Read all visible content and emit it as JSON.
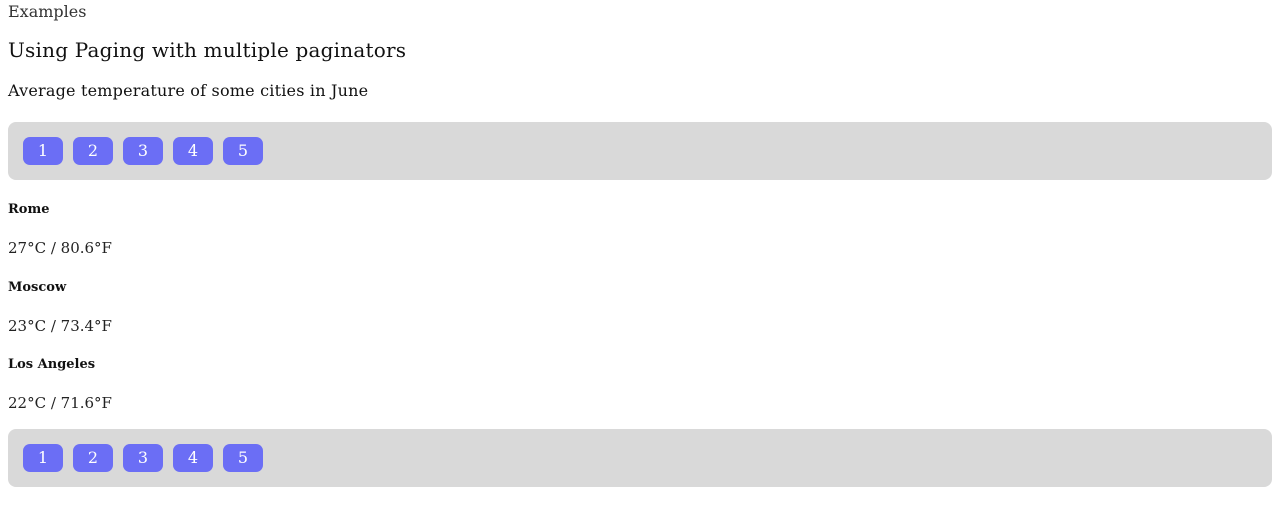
{
  "breadcrumb": "Examples",
  "title": "Using Paging with multiple paginators",
  "subtitle": "Average temperature of some cities in June",
  "paginator_top": {
    "pages": [
      "1",
      "2",
      "3",
      "4",
      "5"
    ]
  },
  "paginator_bottom": {
    "pages": [
      "1",
      "2",
      "3",
      "4",
      "5"
    ]
  },
  "cities": [
    {
      "name": "Rome",
      "temp": "27°C / 80.6°F"
    },
    {
      "name": "Moscow",
      "temp": "23°C / 73.4°F"
    },
    {
      "name": "Los Angeles",
      "temp": "22°C / 71.6°F"
    }
  ],
  "colors": {
    "button": "#6b6ef5",
    "paginator_bg": "#d9d9d9"
  }
}
